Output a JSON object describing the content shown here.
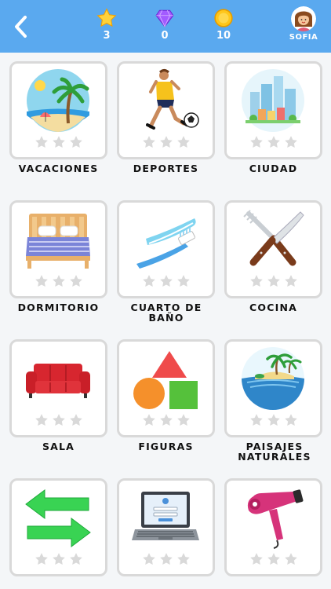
{
  "header": {
    "back_icon": "chevron-left-icon",
    "stats": [
      {
        "icon": "star-icon",
        "value": "3",
        "color": "#ffd23a"
      },
      {
        "icon": "gem-icon",
        "value": "0",
        "color": "#9b4dff"
      },
      {
        "icon": "coin-icon",
        "value": "10",
        "color": "#ffc61a"
      }
    ],
    "user": {
      "name": "SOFIA",
      "icon": "avatar-icon"
    }
  },
  "categories": [
    {
      "label": "VACACIONES",
      "icon": "beach-icon",
      "stars": 0
    },
    {
      "label": "DEPORTES",
      "icon": "soccer-player-icon",
      "stars": 0
    },
    {
      "label": "CIUDAD",
      "icon": "city-icon",
      "stars": 0
    },
    {
      "label": "DORMITORIO",
      "icon": "bed-icon",
      "stars": 0
    },
    {
      "label": "CUARTO DE BAÑO",
      "icon": "toothbrush-icon",
      "stars": 0
    },
    {
      "label": "COCINA",
      "icon": "knife-fork-icon",
      "stars": 0
    },
    {
      "label": "SALA",
      "icon": "sofa-icon",
      "stars": 0
    },
    {
      "label": "FIGURAS",
      "icon": "shapes-icon",
      "stars": 0
    },
    {
      "label": "PAISAJES NATURALES",
      "icon": "island-icon",
      "stars": 0
    },
    {
      "label": "",
      "icon": "arrows-icon",
      "stars": 0
    },
    {
      "label": "",
      "icon": "laptop-icon",
      "stars": 0
    },
    {
      "label": "",
      "icon": "hair-dryer-icon",
      "stars": 0
    }
  ],
  "colors": {
    "header": "#5aa9ef",
    "star_empty": "#d9d9d9"
  }
}
